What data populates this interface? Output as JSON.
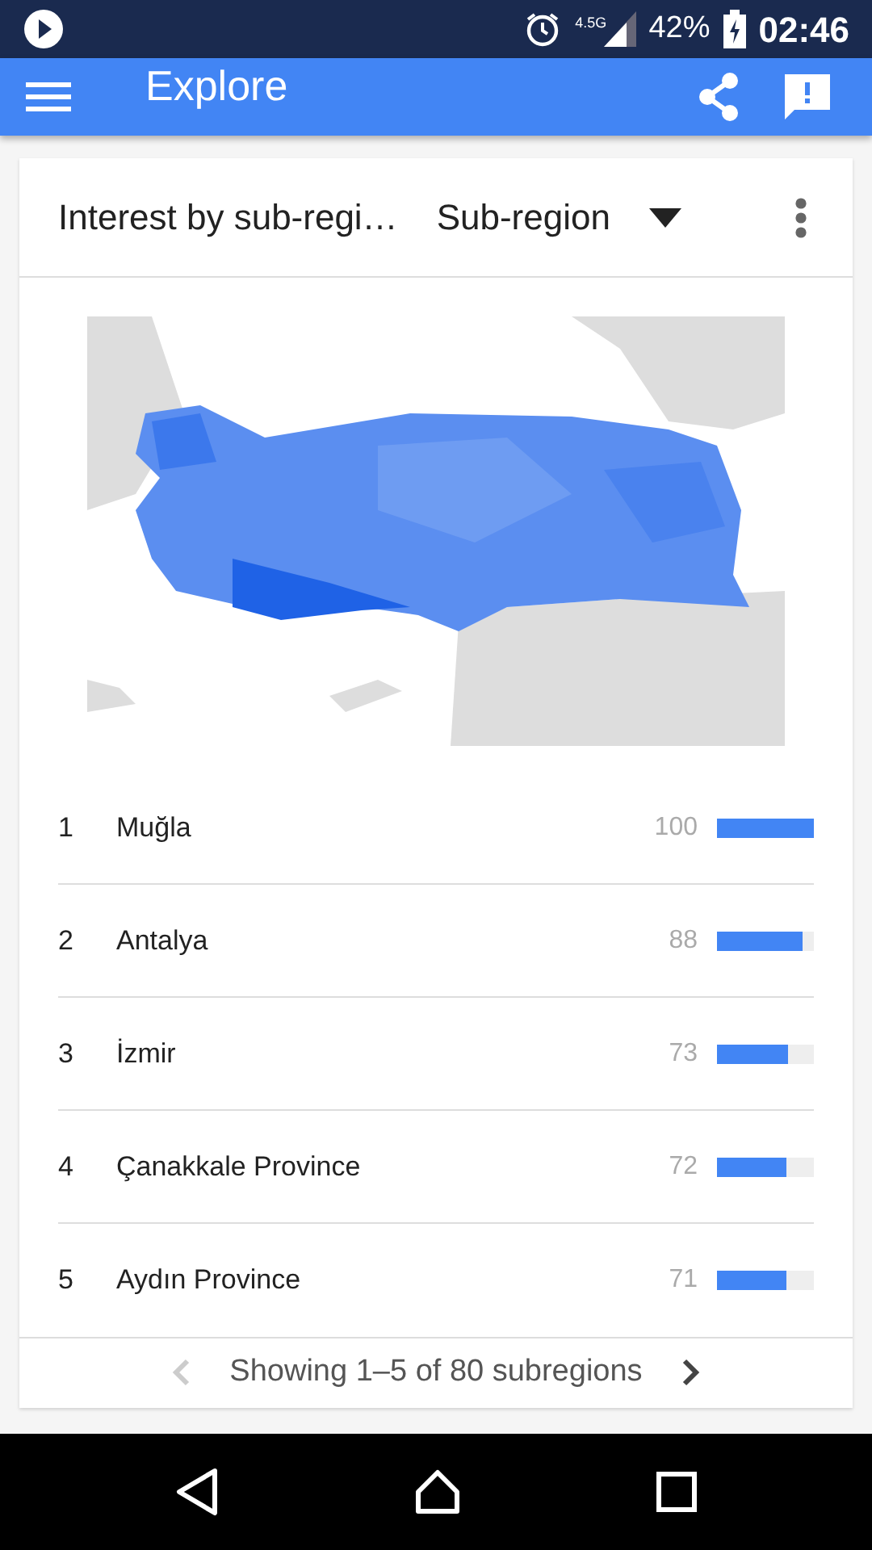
{
  "status_bar": {
    "network": "4.5G",
    "battery": "42%",
    "time": "02:46"
  },
  "app_bar": {
    "title": "Explore"
  },
  "card": {
    "title": "Interest by sub-regi…",
    "dropdown": "Sub-region",
    "rows": [
      {
        "rank": "1",
        "name": "Muğla",
        "value": "100",
        "level": 1.0
      },
      {
        "rank": "2",
        "name": "Antalya",
        "value": "88",
        "level": 0.88
      },
      {
        "rank": "3",
        "name": "İzmir",
        "value": "73",
        "level": 0.73
      },
      {
        "rank": "4",
        "name": "Çanakkale Province",
        "value": "72",
        "level": 0.72
      },
      {
        "rank": "5",
        "name": "Aydın Province",
        "value": "71",
        "level": 0.71
      }
    ],
    "footer": {
      "text": "Showing 1–5 of 80 subregions",
      "prev_disabled": true
    }
  }
}
